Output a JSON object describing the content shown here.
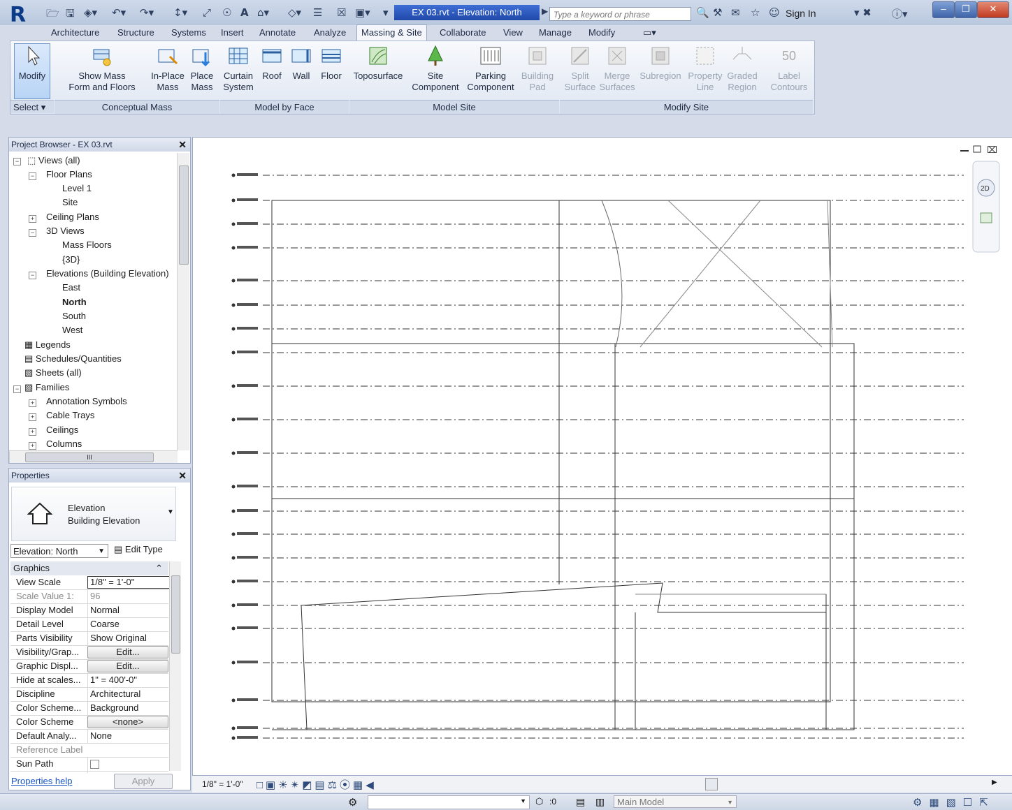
{
  "titlebar": {
    "doc_title": "EX 03.rvt - Elevation: North",
    "search_placeholder": "Type a keyword or phrase",
    "sign_in": "Sign In"
  },
  "ribbon_tabs": [
    "Architecture",
    "Structure",
    "Systems",
    "Insert",
    "Annotate",
    "Analyze",
    "Massing & Site",
    "Collaborate",
    "View",
    "Manage",
    "Modify"
  ],
  "active_tab": "Massing & Site",
  "ribbon": {
    "modify": "Modify",
    "select": "Select",
    "buttons": [
      {
        "l1": "Show Mass",
        "l2": "Form and Floors"
      },
      {
        "l1": "In-Place",
        "l2": "Mass"
      },
      {
        "l1": "Place",
        "l2": "Mass"
      },
      {
        "l1": "Curtain",
        "l2": "System"
      },
      {
        "l1": "Roof",
        "l2": ""
      },
      {
        "l1": "Wall",
        "l2": ""
      },
      {
        "l1": "Floor",
        "l2": ""
      },
      {
        "l1": "Toposurface",
        "l2": ""
      },
      {
        "l1": "Site",
        "l2": "Component"
      },
      {
        "l1": "Parking",
        "l2": "Component"
      },
      {
        "l1": "Building",
        "l2": "Pad"
      },
      {
        "l1": "Split",
        "l2": "Surface"
      },
      {
        "l1": "Merge",
        "l2": "Surfaces"
      },
      {
        "l1": "Subregion",
        "l2": ""
      },
      {
        "l1": "Property",
        "l2": "Line"
      },
      {
        "l1": "Graded",
        "l2": "Region"
      },
      {
        "l1": "Label",
        "l2": "Contours"
      }
    ],
    "groups": [
      "Conceptual Mass",
      "Model by Face",
      "Model Site",
      "Modify Site"
    ],
    "contours_icon_text": "50"
  },
  "project_browser": {
    "title": "Project Browser - EX 03.rvt",
    "items": [
      {
        "label": "Views (all)"
      },
      {
        "label": "Floor Plans"
      },
      {
        "label": "Level 1"
      },
      {
        "label": "Site"
      },
      {
        "label": "Ceiling Plans"
      },
      {
        "label": "3D Views"
      },
      {
        "label": "Mass Floors"
      },
      {
        "label": "{3D}"
      },
      {
        "label": "Elevations (Building Elevation)"
      },
      {
        "label": "East"
      },
      {
        "label": "North"
      },
      {
        "label": "South"
      },
      {
        "label": "West"
      },
      {
        "label": "Legends"
      },
      {
        "label": "Schedules/Quantities"
      },
      {
        "label": "Sheets (all)"
      },
      {
        "label": "Families"
      },
      {
        "label": "Annotation Symbols"
      },
      {
        "label": "Cable Trays"
      },
      {
        "label": "Ceilings"
      },
      {
        "label": "Columns"
      }
    ],
    "scroll_grip": "III"
  },
  "properties": {
    "title": "Properties",
    "type_line1": "Elevation",
    "type_line2": "Building Elevation",
    "instance_selector": "Elevation: North",
    "edit_type": "Edit Type",
    "section": "Graphics",
    "rows": [
      {
        "k": "View Scale",
        "v": "1/8\" = 1'-0\""
      },
      {
        "k": "Scale Value    1:",
        "v": "96"
      },
      {
        "k": "Display Model",
        "v": "Normal"
      },
      {
        "k": "Detail Level",
        "v": "Coarse"
      },
      {
        "k": "Parts Visibility",
        "v": "Show Original"
      },
      {
        "k": "Visibility/Grap...",
        "v": "Edit..."
      },
      {
        "k": "Graphic Displ...",
        "v": "Edit..."
      },
      {
        "k": "Hide at scales...",
        "v": "1\" = 400'-0\""
      },
      {
        "k": "Discipline",
        "v": "Architectural"
      },
      {
        "k": "Color Scheme...",
        "v": "Background"
      },
      {
        "k": "Color Scheme",
        "v": "<none>"
      },
      {
        "k": "Default Analy...",
        "v": "None"
      },
      {
        "k": "Reference Label",
        "v": ""
      },
      {
        "k": "Sun Path",
        "v": ""
      }
    ],
    "help": "Properties help",
    "apply": "Apply"
  },
  "view_control_bar": {
    "scale": "1/8\" = 1'-0\""
  },
  "status_bar": {
    "count": ":0",
    "model": "Main Model"
  }
}
